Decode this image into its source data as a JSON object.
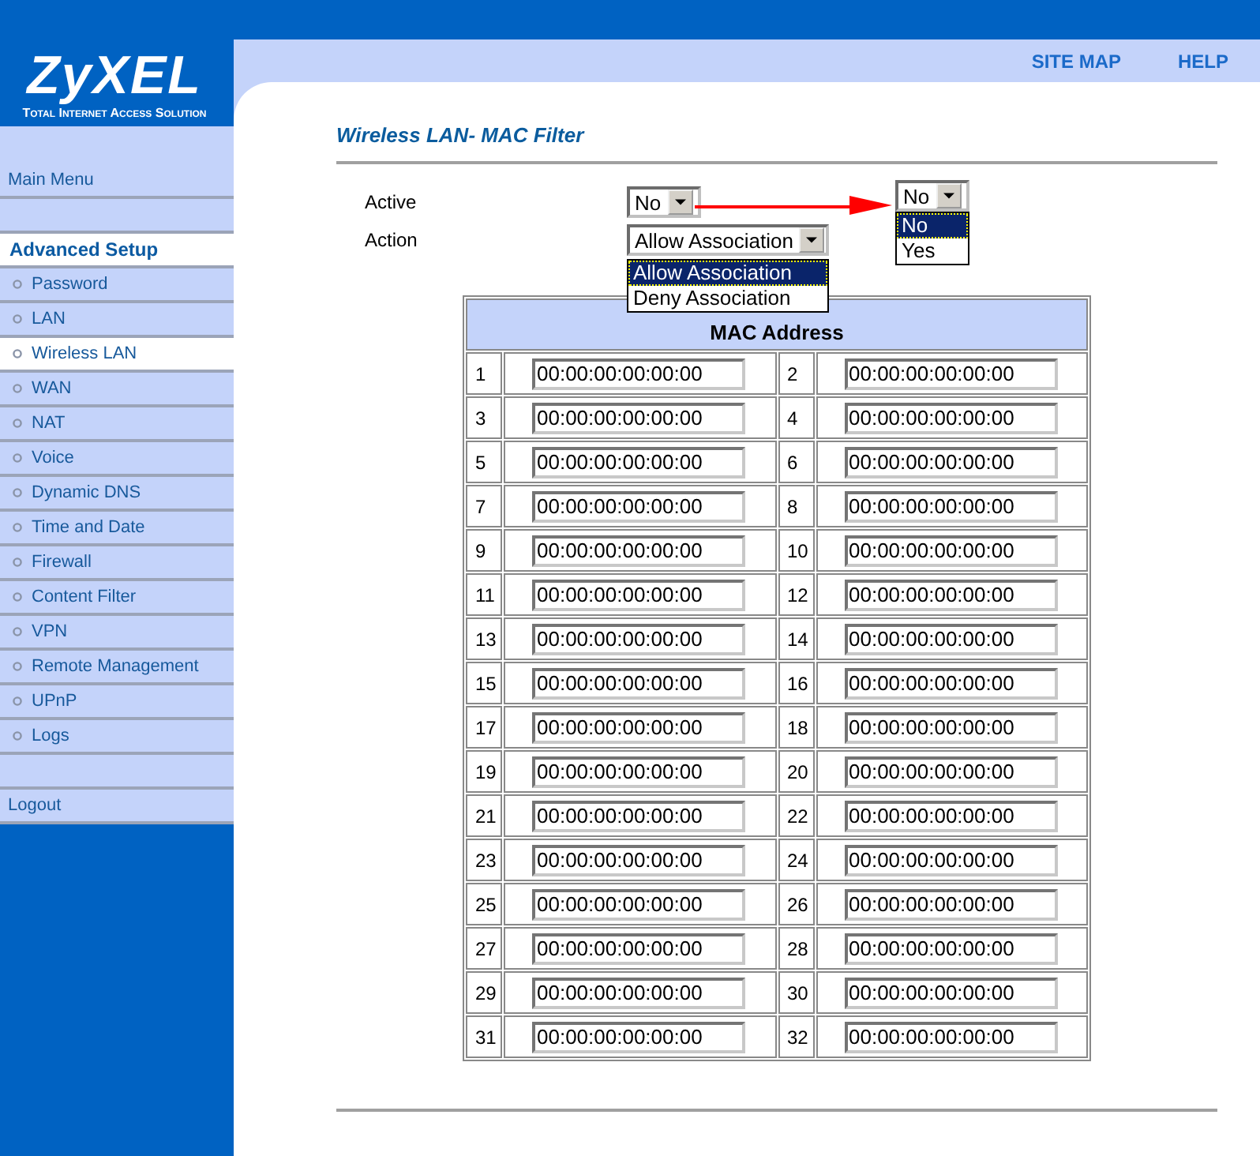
{
  "logo": {
    "name": "ZyXEL",
    "tagline": "Total Internet Access Solution"
  },
  "top_links": [
    "SITE MAP",
    "HELP"
  ],
  "sidebar": {
    "items": [
      {
        "kind": "link",
        "label": "Main Menu",
        "selected": false
      },
      {
        "kind": "spacer"
      },
      {
        "kind": "heading",
        "label": "Advanced Setup"
      },
      {
        "kind": "item",
        "label": "Password",
        "selected": false
      },
      {
        "kind": "item",
        "label": "LAN",
        "selected": false
      },
      {
        "kind": "item",
        "label": "Wireless LAN",
        "selected": true
      },
      {
        "kind": "item",
        "label": "WAN",
        "selected": false
      },
      {
        "kind": "item",
        "label": "NAT",
        "selected": false
      },
      {
        "kind": "item",
        "label": "Voice",
        "selected": false
      },
      {
        "kind": "item",
        "label": "Dynamic DNS",
        "selected": false
      },
      {
        "kind": "item",
        "label": "Time and Date",
        "selected": false
      },
      {
        "kind": "item",
        "label": "Firewall",
        "selected": false
      },
      {
        "kind": "item",
        "label": "Content Filter",
        "selected": false
      },
      {
        "kind": "item",
        "label": "VPN",
        "selected": false
      },
      {
        "kind": "item",
        "label": "Remote Management",
        "selected": false
      },
      {
        "kind": "item",
        "label": "UPnP",
        "selected": false
      },
      {
        "kind": "item",
        "label": "Logs",
        "selected": false
      },
      {
        "kind": "spacer"
      },
      {
        "kind": "link",
        "label": "Logout",
        "selected": false
      }
    ]
  },
  "page_title": "Wireless LAN- MAC Filter",
  "form": {
    "active": {
      "label": "Active",
      "value": "No"
    },
    "action": {
      "label": "Action",
      "value": "Allow Association",
      "options": [
        {
          "label": "Allow Association",
          "selected": true
        },
        {
          "label": "Deny Association",
          "selected": false
        }
      ]
    }
  },
  "callout": {
    "value": "No",
    "options": [
      {
        "label": "No",
        "selected": true
      },
      {
        "label": "Yes",
        "selected": false
      }
    ]
  },
  "mac_table": {
    "header": "MAC Address",
    "entries": [
      {
        "index": "1",
        "value": "00:00:00:00:00:00"
      },
      {
        "index": "2",
        "value": "00:00:00:00:00:00"
      },
      {
        "index": "3",
        "value": "00:00:00:00:00:00"
      },
      {
        "index": "4",
        "value": "00:00:00:00:00:00"
      },
      {
        "index": "5",
        "value": "00:00:00:00:00:00"
      },
      {
        "index": "6",
        "value": "00:00:00:00:00:00"
      },
      {
        "index": "7",
        "value": "00:00:00:00:00:00"
      },
      {
        "index": "8",
        "value": "00:00:00:00:00:00"
      },
      {
        "index": "9",
        "value": "00:00:00:00:00:00"
      },
      {
        "index": "10",
        "value": "00:00:00:00:00:00"
      },
      {
        "index": "11",
        "value": "00:00:00:00:00:00"
      },
      {
        "index": "12",
        "value": "00:00:00:00:00:00"
      },
      {
        "index": "13",
        "value": "00:00:00:00:00:00"
      },
      {
        "index": "14",
        "value": "00:00:00:00:00:00"
      },
      {
        "index": "15",
        "value": "00:00:00:00:00:00"
      },
      {
        "index": "16",
        "value": "00:00:00:00:00:00"
      },
      {
        "index": "17",
        "value": "00:00:00:00:00:00"
      },
      {
        "index": "18",
        "value": "00:00:00:00:00:00"
      },
      {
        "index": "19",
        "value": "00:00:00:00:00:00"
      },
      {
        "index": "20",
        "value": "00:00:00:00:00:00"
      },
      {
        "index": "21",
        "value": "00:00:00:00:00:00"
      },
      {
        "index": "22",
        "value": "00:00:00:00:00:00"
      },
      {
        "index": "23",
        "value": "00:00:00:00:00:00"
      },
      {
        "index": "24",
        "value": "00:00:00:00:00:00"
      },
      {
        "index": "25",
        "value": "00:00:00:00:00:00"
      },
      {
        "index": "26",
        "value": "00:00:00:00:00:00"
      },
      {
        "index": "27",
        "value": "00:00:00:00:00:00"
      },
      {
        "index": "28",
        "value": "00:00:00:00:00:00"
      },
      {
        "index": "29",
        "value": "00:00:00:00:00:00"
      },
      {
        "index": "30",
        "value": "00:00:00:00:00:00"
      },
      {
        "index": "31",
        "value": "00:00:00:00:00:00"
      },
      {
        "index": "32",
        "value": "00:00:00:00:00:00"
      }
    ]
  }
}
